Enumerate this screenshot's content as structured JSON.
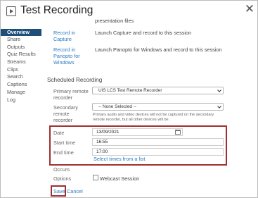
{
  "window": {
    "title": "Test Recording"
  },
  "sidebar": {
    "items": [
      {
        "label": "Overview",
        "active": true
      },
      {
        "label": "Share"
      },
      {
        "label": "Outputs"
      },
      {
        "label": "Quiz Results"
      },
      {
        "label": "Streams"
      },
      {
        "label": "Clips"
      },
      {
        "label": "Search"
      },
      {
        "label": "Captions"
      },
      {
        "label": "Manage"
      },
      {
        "label": "Log"
      }
    ]
  },
  "options": {
    "partial_text": "presentation files",
    "record_capture": {
      "link_line1": "Record in",
      "link_line2": "Capture",
      "description": "Launch Capture and record to this session"
    },
    "record_panopto": {
      "link_line1": "Record in",
      "link_line2": "Panopto for",
      "link_line3": "Windows",
      "description": "Launch Panopto for Windows and record to this session"
    }
  },
  "scheduled": {
    "heading": "Scheduled Recording",
    "primary": {
      "label_line1": "Primary remote",
      "label_line2": "recorder",
      "value": "UIS LCS Test Remote Recorder"
    },
    "secondary": {
      "label_line1": "Secondary",
      "label_line2": "remote",
      "label_line3": "recorder",
      "value": "-- None Selected --",
      "note": "Primary audio and video devices will not be captured on the secondary remote recorder, but all other devices will be."
    },
    "date": {
      "label": "Date",
      "value": "13/09/2021"
    },
    "start_time": {
      "label": "Start time",
      "value": "16:55"
    },
    "end_time": {
      "label": "End time",
      "value": "17:00"
    },
    "select_times_link": "Select times from a list",
    "occurs": {
      "label": "Occurs"
    },
    "options_row": {
      "label": "Options",
      "checkbox_label": "Webcast Session",
      "checked": false
    }
  },
  "actions": {
    "save": "Save",
    "cancel": "Cancel"
  },
  "colors": {
    "highlight": "#a03030",
    "link": "#2a7ac0",
    "nav_active": "#1f4e79"
  }
}
